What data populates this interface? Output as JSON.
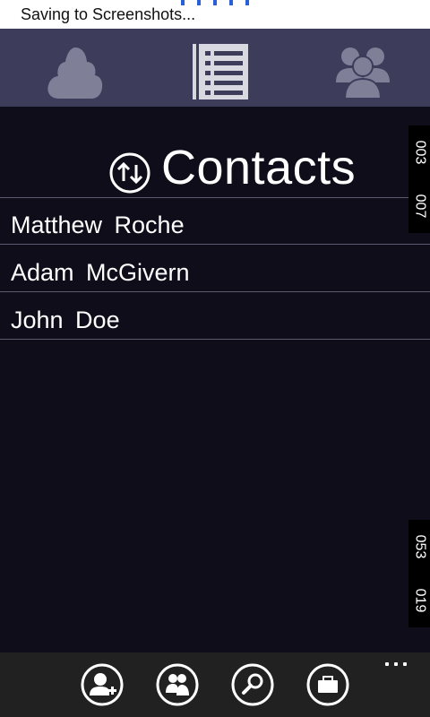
{
  "status_bar": {
    "message": "Saving to Screenshots..."
  },
  "top_nav": {
    "items": [
      {
        "icon": "cloud-icon"
      },
      {
        "icon": "list-icon",
        "selected": true
      },
      {
        "icon": "people-icon"
      }
    ]
  },
  "header": {
    "title": "Contacts",
    "sort_icon": "sort-arrows-icon"
  },
  "contacts": [
    {
      "name": "Matthew Roche"
    },
    {
      "name": "Adam McGivern"
    },
    {
      "name": "John Doe"
    }
  ],
  "side_tags": {
    "top": [
      "003",
      "007"
    ],
    "bottom": [
      "053",
      "019"
    ]
  },
  "app_bar": {
    "buttons": [
      {
        "icon": "add-contact-icon"
      },
      {
        "icon": "group-icon"
      },
      {
        "icon": "search-icon"
      },
      {
        "icon": "briefcase-icon"
      }
    ],
    "more_icon": "more-dots-icon"
  },
  "colors": {
    "background": "#0e0d19",
    "top_nav": "#3d3d5b",
    "nav_icon": "#7f7f97",
    "nav_icon_selected": "#d8d8e0",
    "app_bar": "#212121",
    "progress_dots": "#2a5fd6"
  }
}
